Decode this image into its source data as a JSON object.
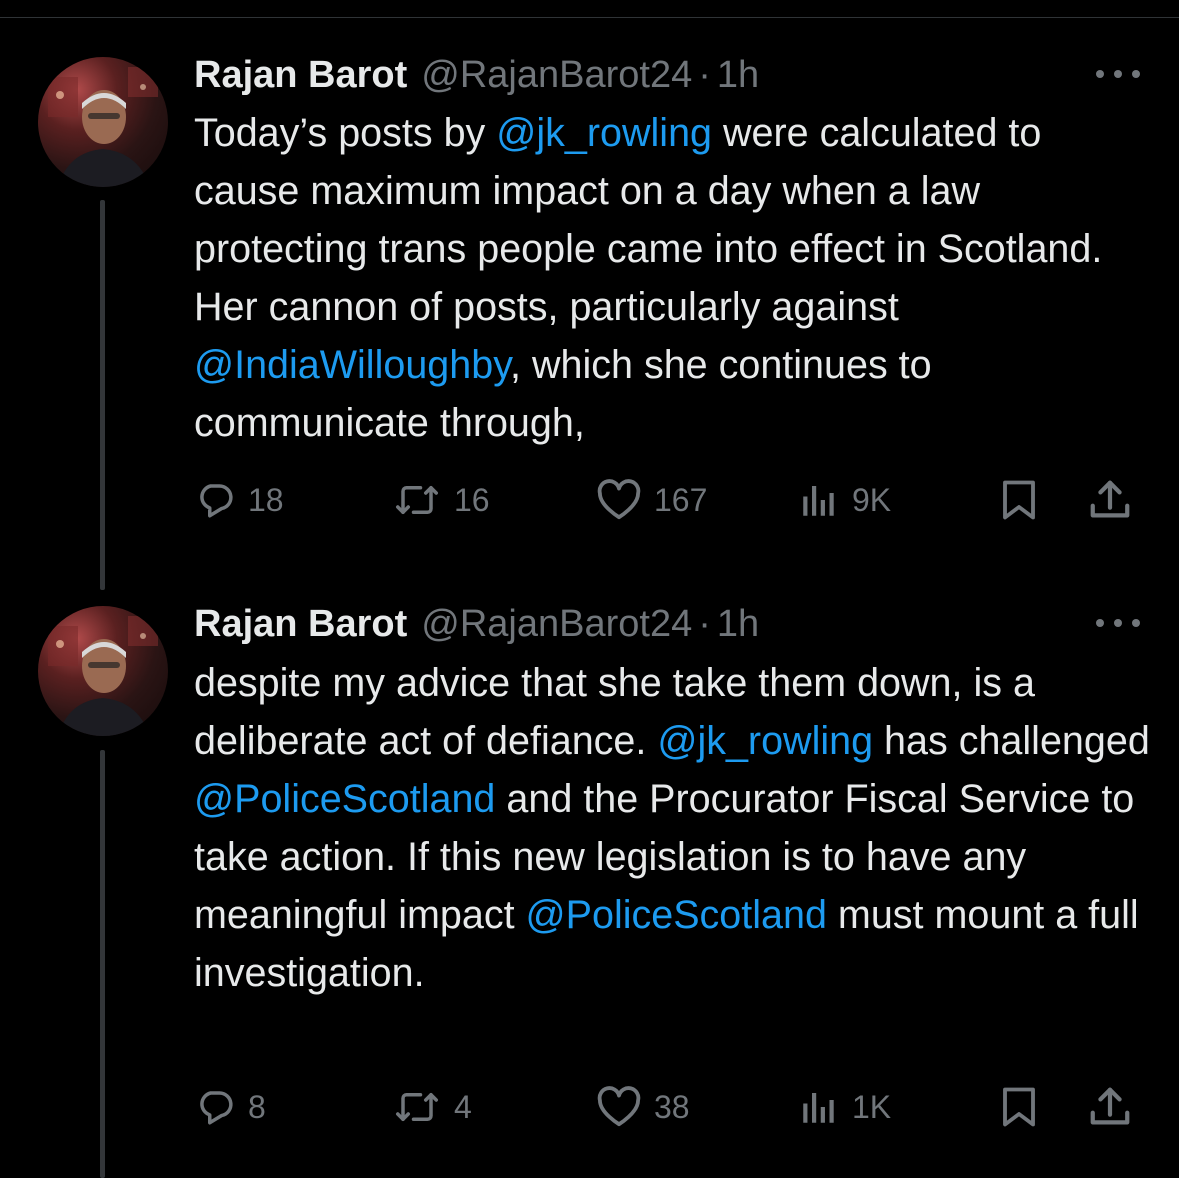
{
  "tweets": [
    {
      "author_name": "Rajan Barot",
      "handle": "@RajanBarot24",
      "separator": "·",
      "time": "1h",
      "body": [
        {
          "text": "Today’s posts by ",
          "link": false
        },
        {
          "text": "@jk_rowling",
          "link": true
        },
        {
          "text": " were calculated to cause maximum impact on a day when a law protecting trans people came into effect in Scotland. Her cannon of posts, particularly against ",
          "link": false
        },
        {
          "text": "@IndiaWilloughby",
          "link": true
        },
        {
          "text": ", which she continues to communicate through,",
          "link": false
        }
      ],
      "stats": {
        "replies": "18",
        "reposts": "16",
        "likes": "167",
        "views": "9K"
      }
    },
    {
      "author_name": "Rajan Barot",
      "handle": "@RajanBarot24",
      "separator": "·",
      "time": "1h",
      "body": [
        {
          "text": "despite my advice that she take them down, is a deliberate act of defiance. ",
          "link": false
        },
        {
          "text": "@jk_rowling",
          "link": true
        },
        {
          "text": " has challenged ",
          "link": false
        },
        {
          "text": "@PoliceScotland",
          "link": true
        },
        {
          "text": " and the Procurator Fiscal Service to take action. If this new legislation is to have any meaningful impact ",
          "link": false
        },
        {
          "text": "@PoliceScotland",
          "link": true
        },
        {
          "text": " must mount a full investigation.",
          "link": false
        }
      ],
      "stats": {
        "replies": "8",
        "reposts": "4",
        "likes": "38",
        "views": "1K"
      }
    }
  ],
  "icons": [
    "reply-icon",
    "repost-icon",
    "like-icon",
    "views-icon",
    "bookmark-icon",
    "share-icon",
    "more-icon"
  ],
  "colors": {
    "background": "#000000",
    "text": "#e7e9ea",
    "muted": "#71767b",
    "link": "#1d9bf0",
    "thread_line": "#333639"
  }
}
